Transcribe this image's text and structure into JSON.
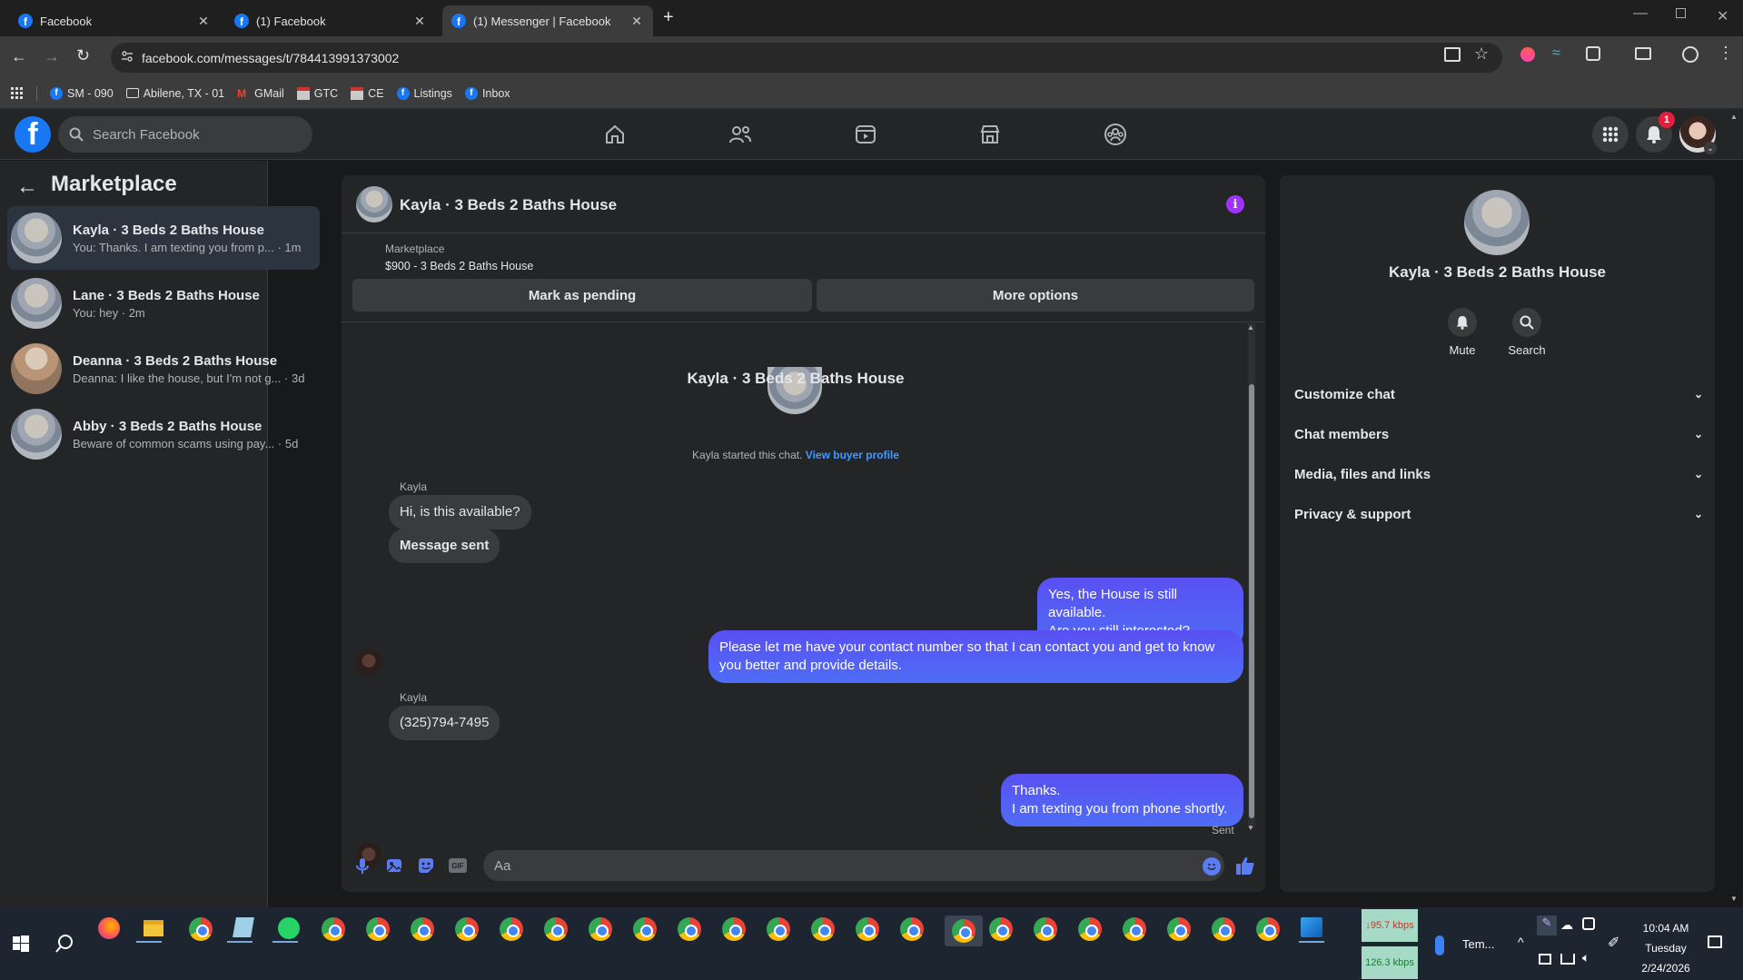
{
  "browser": {
    "tabs": [
      {
        "title": "Facebook"
      },
      {
        "title": "(1) Facebook"
      },
      {
        "title": "(1) Messenger | Facebook"
      }
    ],
    "url": "facebook.com/messages/t/784413991373002",
    "bookmarks": [
      {
        "label": "SM - 090",
        "icon": "facebook-icon"
      },
      {
        "label": "Abilene, TX - 01",
        "icon": "folder-icon"
      },
      {
        "label": "GMail",
        "icon": "gmail-icon"
      },
      {
        "label": "GTC",
        "icon": "page-icon"
      },
      {
        "label": "CE",
        "icon": "page-icon"
      },
      {
        "label": "Listings",
        "icon": "facebook-icon"
      },
      {
        "label": "Inbox",
        "icon": "facebook-icon"
      }
    ]
  },
  "header": {
    "search_placeholder": "Search Facebook",
    "notification_count": "1"
  },
  "sidebar": {
    "title": "Marketplace",
    "conversations": [
      {
        "name": "Kayla · 3 Beds 2 Baths House",
        "preview": "You: Thanks. I am texting you from p...",
        "time": "· 1m",
        "selected": true
      },
      {
        "name": "Lane · 3 Beds 2 Baths House",
        "preview": "You: hey",
        "time": "· 2m",
        "selected": false
      },
      {
        "name": "Deanna · 3 Beds 2 Baths House",
        "preview": "Deanna: I like the house, but I'm not g...",
        "time": "· 3d",
        "selected": false
      },
      {
        "name": "Abby · 3 Beds 2 Baths House",
        "preview": "Beware of common scams using pay...",
        "time": "· 5d",
        "selected": false
      }
    ]
  },
  "chat": {
    "title": "Kayla · 3 Beds 2 Baths House",
    "listing_label": "Marketplace",
    "listing_detail": "$900 - 3 Beds 2 Baths House",
    "mark_pending": "Mark as pending",
    "more_options": "More options",
    "intro_name": "Kayla · 3 Beds 2 Baths House",
    "started_text": "Kayla started this chat.",
    "view_buyer": "View buyer profile",
    "sender_name_1": "Kayla",
    "msg_in_1": "Hi, is this available?",
    "msg_in_2": "Message sent",
    "msg_out_1_line1": "Yes, the House is still available.",
    "msg_out_1_line2": "Are you still interested?",
    "msg_out_2_line1": "Please let me have your contact number so that I can contact you and get to know",
    "msg_out_2_line2": "you better and provide details.",
    "sender_name_2": "Kayla",
    "msg_in_3": "(325)794-7495",
    "msg_out_3_line1": "Thanks.",
    "msg_out_3_line2": "I am texting you from phone shortly.",
    "status": "Sent",
    "composer_placeholder": "Aa"
  },
  "info_panel": {
    "name": "Kayla · 3 Beds 2 Baths House",
    "mute_label": "Mute",
    "search_label": "Search",
    "sections": [
      "Customize chat",
      "Chat members",
      "Media, files and links",
      "Privacy & support"
    ]
  },
  "taskbar": {
    "net_down": "↓95.7 kbps",
    "net_up": "126.3 kbps",
    "weather": "Tem...",
    "time": "10:04 AM",
    "day": "Tuesday",
    "date": "2/24/2026"
  },
  "colors": {
    "accent": "#5b4cf3",
    "fb_blue": "#1877f2",
    "link": "#4599ff",
    "info_purple": "#a033ff"
  }
}
